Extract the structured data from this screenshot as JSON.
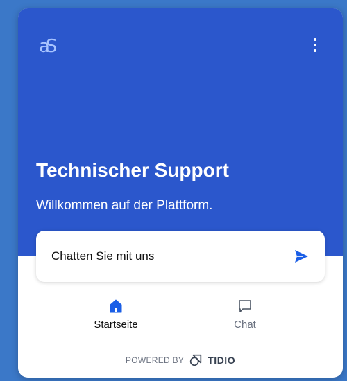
{
  "header": {
    "logo_text": "aS",
    "menu_icon": "more-vertical-icon",
    "title": "Technischer Support",
    "subtitle": "Willkommen auf der Plattform."
  },
  "chat_card": {
    "label": "Chatten Sie mit uns",
    "icon": "send-icon"
  },
  "nav": {
    "items": [
      {
        "label": "Startseite",
        "icon": "home-icon",
        "active": true
      },
      {
        "label": "Chat",
        "icon": "chat-bubble-icon",
        "active": false
      }
    ]
  },
  "footer": {
    "powered_by": "POWERED BY",
    "brand": "TIDIO",
    "icon": "tidio-logo-icon"
  },
  "colors": {
    "page_background": "#3b78c8",
    "hero_background": "#2b57cc",
    "accent": "#1a5ee6",
    "muted_text": "#6b7280"
  }
}
